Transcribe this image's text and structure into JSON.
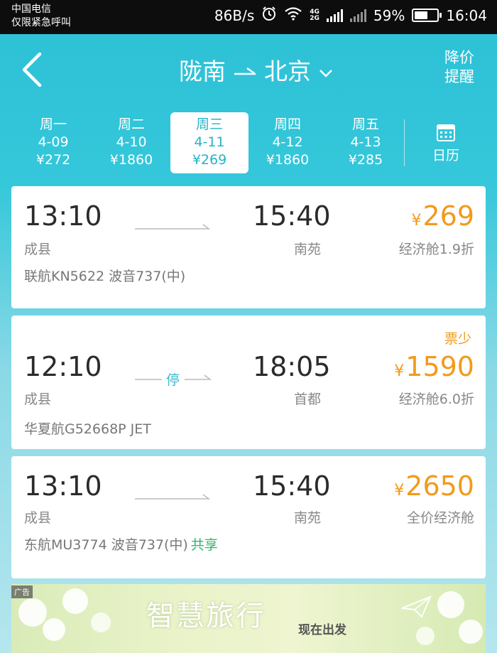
{
  "status_bar": {
    "carrier_line1": "中国电信",
    "carrier_line2": "仅限紧急呼叫",
    "speed": "86B/s",
    "battery": "59%",
    "battery_level": 0.59,
    "time": "16:04",
    "network_top": "4G",
    "network_bottom": "2G",
    "icons": [
      "alarm-icon",
      "wifi-icon",
      "signal-icon",
      "no-signal-icon",
      "battery-icon"
    ]
  },
  "header": {
    "from": "陇南",
    "to": "北京",
    "alert_line1": "降价",
    "alert_line2": "提醒"
  },
  "dates": [
    {
      "weekday": "周一",
      "date": "4-09",
      "price": "¥272"
    },
    {
      "weekday": "周二",
      "date": "4-10",
      "price": "¥1860"
    },
    {
      "weekday": "周三",
      "date": "4-11",
      "price": "¥269",
      "active": true
    },
    {
      "weekday": "周四",
      "date": "4-12",
      "price": "¥1860"
    },
    {
      "weekday": "周五",
      "date": "4-13",
      "price": "¥285"
    }
  ],
  "calendar_label": "日历",
  "flights": [
    {
      "dep_time": "13:10",
      "arr_time": "15:40",
      "dep_airport": "成县",
      "arr_airport": "南苑",
      "yen": "¥",
      "price": "269",
      "cabin": "经济舱1.9折",
      "info": "联航KN5622 波音737(中)",
      "stop": "",
      "tag": "",
      "share": ""
    },
    {
      "dep_time": "12:10",
      "arr_time": "18:05",
      "dep_airport": "成县",
      "arr_airport": "首都",
      "yen": "¥",
      "price": "1590",
      "cabin": "经济舱6.0折",
      "info": "华夏航G52668P JET",
      "stop": "停",
      "tag": "票少",
      "share": ""
    },
    {
      "dep_time": "13:10",
      "arr_time": "15:40",
      "dep_airport": "成县",
      "arr_airport": "南苑",
      "yen": "¥",
      "price": "2650",
      "cabin": "全价经济舱",
      "info": "东航MU3774 波音737(中)",
      "stop": "",
      "tag": "",
      "share": "共享"
    }
  ],
  "ad": {
    "badge": "广告",
    "title": "智慧旅行",
    "subtitle": "现在出发"
  },
  "colors": {
    "accent": "#2cc0d6",
    "price": "#f29a1c",
    "share": "#2fb36a"
  }
}
